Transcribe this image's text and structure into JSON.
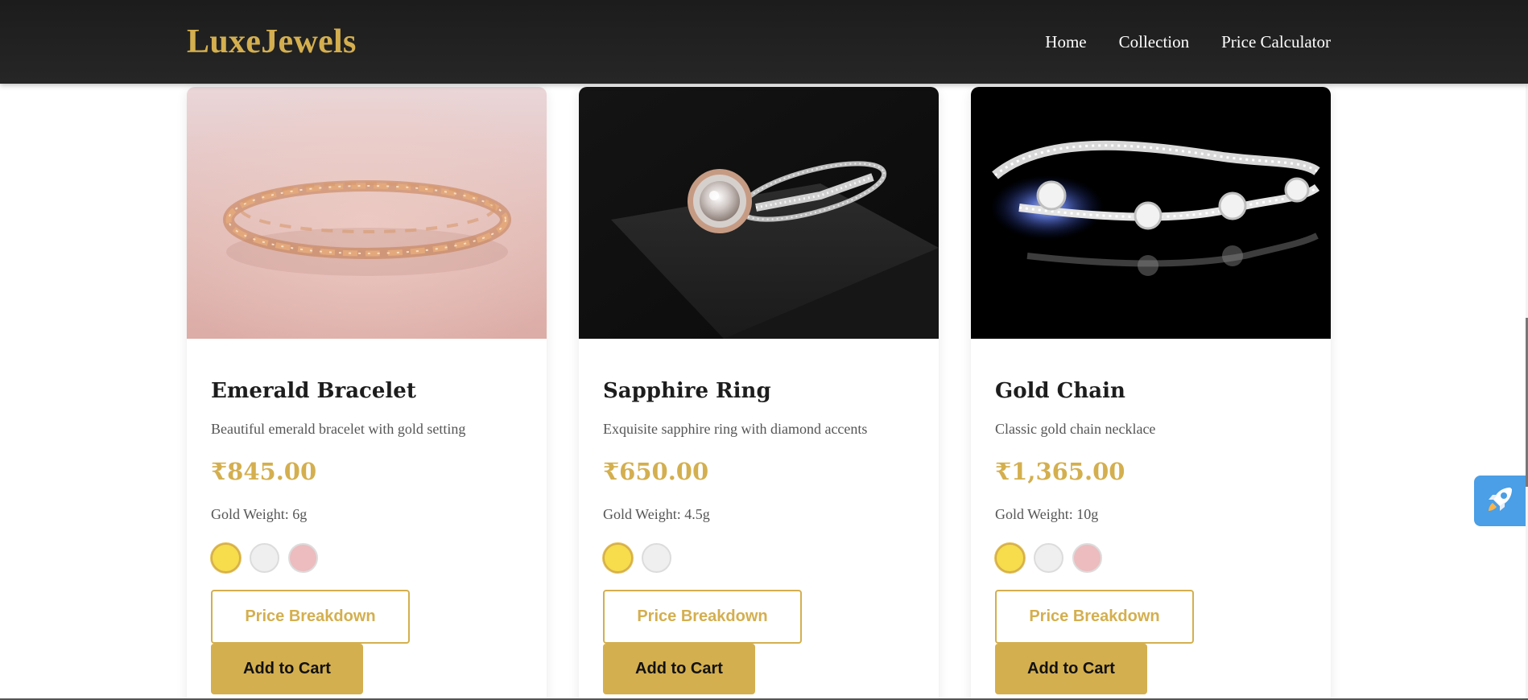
{
  "brand": {
    "logo_text": "LuxeJewels",
    "accent_color": "#d4af4f"
  },
  "nav": {
    "items": [
      {
        "label": "Home"
      },
      {
        "label": "Collection"
      },
      {
        "label": "Price Calculator"
      }
    ]
  },
  "products": [
    {
      "name": "Emerald Bracelet",
      "description": "Beautiful emerald bracelet with gold setting",
      "price": "₹845.00",
      "weight": "Gold Weight: 6g",
      "image": "rose-gold-bracelet-photo",
      "metal_options": [
        {
          "name": "yellow-gold",
          "color": "#f7dc4b",
          "selected": true
        },
        {
          "name": "white-gold",
          "color": "#efefef",
          "selected": false
        },
        {
          "name": "rose-gold",
          "color": "#ecbcbf",
          "selected": false
        }
      ],
      "breakdown_label": "Price Breakdown",
      "cart_label": "Add to Cart"
    },
    {
      "name": "Sapphire Ring",
      "description": "Exquisite sapphire ring with diamond accents",
      "price": "₹650.00",
      "weight": "Gold Weight: 4.5g",
      "image": "diamond-ring-photo",
      "metal_options": [
        {
          "name": "yellow-gold",
          "color": "#f7dc4b",
          "selected": true
        },
        {
          "name": "white-gold",
          "color": "#efefef",
          "selected": false
        }
      ],
      "breakdown_label": "Price Breakdown",
      "cart_label": "Add to Cart"
    },
    {
      "name": "Gold Chain",
      "description": "Classic gold chain necklace",
      "price": "₹1,365.00",
      "weight": "Gold Weight: 10g",
      "image": "diamond-bracelet-photo",
      "metal_options": [
        {
          "name": "yellow-gold",
          "color": "#f7dc4b",
          "selected": true
        },
        {
          "name": "white-gold",
          "color": "#efefef",
          "selected": false
        },
        {
          "name": "rose-gold",
          "color": "#ecbcbf",
          "selected": false
        }
      ],
      "breakdown_label": "Price Breakdown",
      "cart_label": "Add to Cart"
    }
  ],
  "floating_button": {
    "icon": "rocket-icon",
    "color": "#4a9fe6"
  }
}
